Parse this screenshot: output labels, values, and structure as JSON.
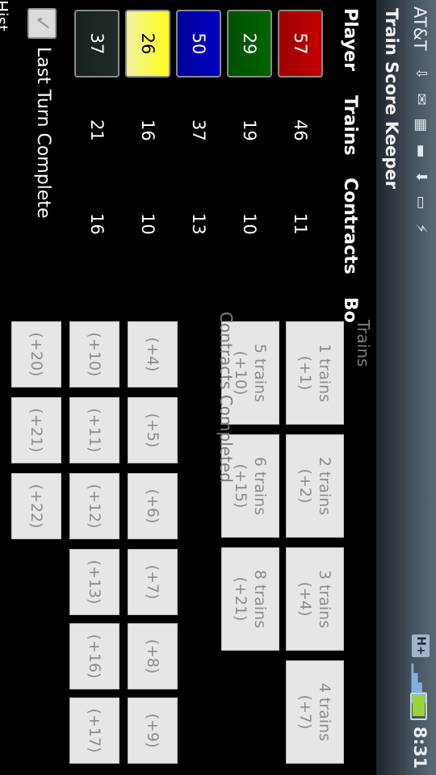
{
  "status_bar": {
    "carrier": "AT&T",
    "network": "H+",
    "time": "8:31"
  },
  "app": {
    "title": "Train Score Keeper"
  },
  "table": {
    "headers": {
      "player": "Player",
      "trains": "Trains",
      "contracts": "Contracts",
      "bonus": "Bo"
    },
    "players": [
      {
        "score": "57",
        "trains": "46",
        "contracts": "11",
        "color": "#c40000"
      },
      {
        "score": "29",
        "trains": "19",
        "contracts": "10",
        "color": "#006400"
      },
      {
        "score": "50",
        "trains": "37",
        "contracts": "13",
        "color": "#0000c0"
      },
      {
        "score": "26",
        "trains": "16",
        "contracts": "10",
        "color": "#f5f514"
      },
      {
        "score": "37",
        "trains": "21",
        "contracts": "16",
        "color": "#1f2a28"
      }
    ]
  },
  "last_turn": {
    "label": "Last Turn Complete",
    "checked": false
  },
  "footer_partial": "Hist",
  "trains_section": {
    "label": "Trains",
    "buttons": [
      {
        "line1": "1 trains",
        "line2": "(+1)"
      },
      {
        "line1": "2 trains",
        "line2": "(+2)"
      },
      {
        "line1": "3 trains",
        "line2": "(+4)"
      },
      {
        "line1": "4 trains",
        "line2": "(+7)"
      },
      {
        "line1": "5 trains",
        "line2": "(+10)"
      },
      {
        "line1": "6 trains",
        "line2": "(+15)"
      },
      {
        "line1": "8 trains",
        "line2": "(+21)"
      }
    ]
  },
  "contracts_section": {
    "label": "Contracts Completed",
    "buttons": [
      "(+4)",
      "(+5)",
      "(+6)",
      "(+7)",
      "(+8)",
      "(+9)",
      "(+10)",
      "(+11)",
      "(+12)",
      "(+13)",
      "(+16)",
      "(+17)",
      "(+20)",
      "(+21)",
      "(+22)"
    ]
  }
}
